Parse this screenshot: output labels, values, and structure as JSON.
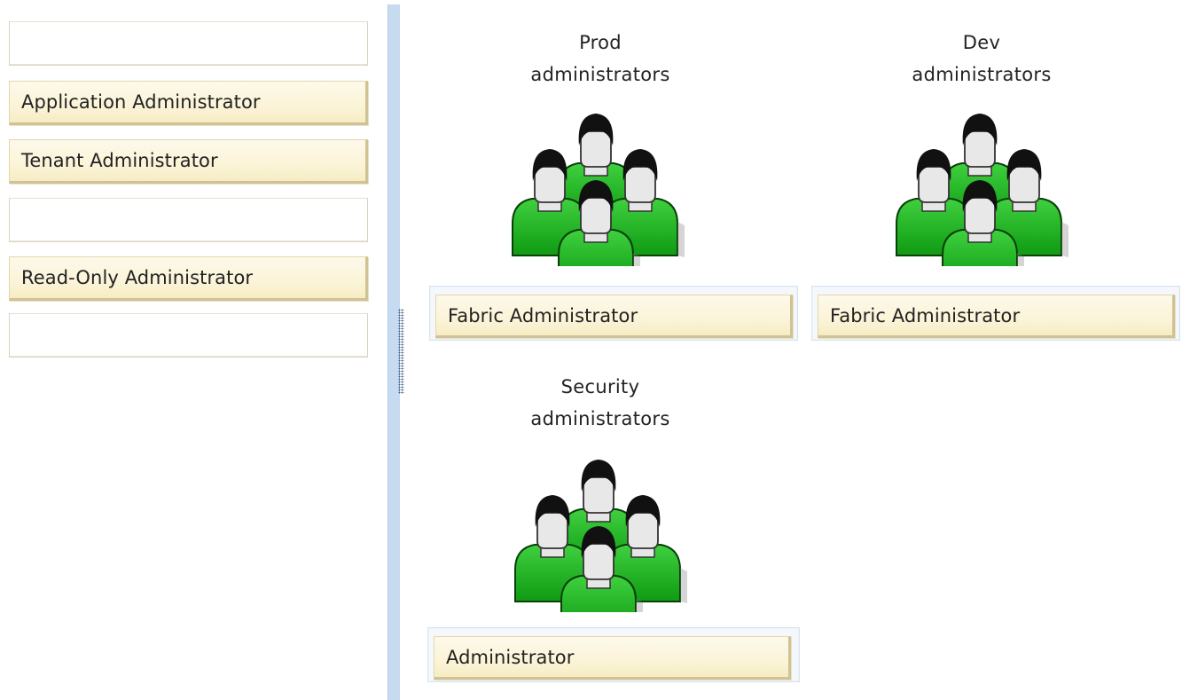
{
  "source_list": {
    "items": [
      {
        "label": ""
      },
      {
        "label": "Application Administrator"
      },
      {
        "label": "Tenant Administrator"
      },
      {
        "label": ""
      },
      {
        "label": "Read-Only Administrator"
      },
      {
        "label": ""
      }
    ]
  },
  "groups": {
    "prod": {
      "title_line1": "Prod",
      "title_line2": "administrators",
      "assigned_role": "Fabric Administrator",
      "icon": "user-group-icon"
    },
    "dev": {
      "title_line1": "Dev",
      "title_line2": "administrators",
      "assigned_role": "Fabric Administrator",
      "icon": "user-group-icon"
    },
    "security": {
      "title_line1": "Security",
      "title_line2": "administrators",
      "assigned_role": "Administrator",
      "icon": "user-group-icon"
    }
  },
  "colors": {
    "chip_fill": "#fbf4d8",
    "chip_border": "#cfc294",
    "splitter": "#c6daf0",
    "figure_green": "#1fae1f",
    "figure_hair": "#111111",
    "figure_face": "#e8e8e8"
  }
}
